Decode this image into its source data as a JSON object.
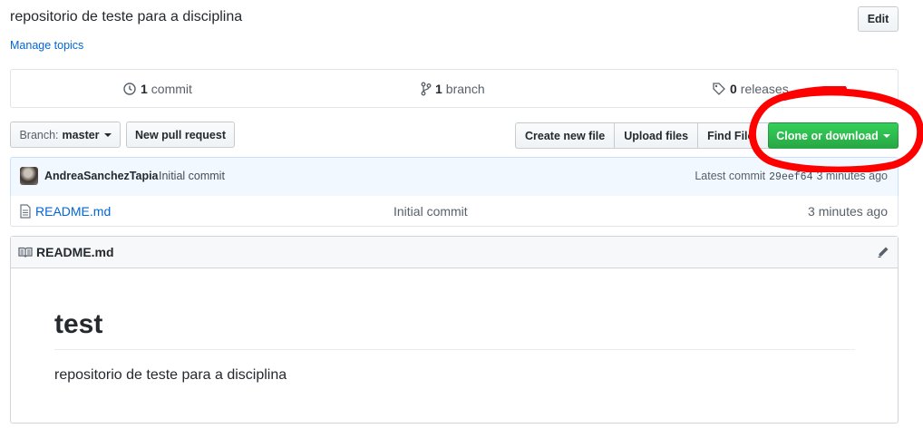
{
  "repo": {
    "description": "repositorio de teste para a disciplina",
    "manage_topics": "Manage topics",
    "edit_label": "Edit"
  },
  "numbers_summary": {
    "commits_count": "1",
    "commits_label": "commit",
    "branches_count": "1",
    "branches_label": "branch",
    "releases_count": "0",
    "releases_label": "releases"
  },
  "toolbar": {
    "branch_label": "Branch:",
    "branch_value": "master",
    "new_pull_request": "New pull request",
    "create_new_file": "Create new file",
    "upload_files": "Upload files",
    "find_file": "Find File",
    "clone_or_download": "Clone or download"
  },
  "latest_commit": {
    "author": "AndreaSanchezTapia",
    "message": "Initial commit",
    "label": "Latest commit",
    "sha": "29eef64",
    "age": "3 minutes ago"
  },
  "files": [
    {
      "name": "README.md",
      "message": "Initial commit",
      "age": "3 minutes ago"
    }
  ],
  "readme": {
    "header_title": "README.md",
    "h1": "test",
    "paragraph": "repositorio de teste para a disciplina"
  },
  "colors": {
    "link": "#0366d6",
    "primary_green": "#28a745",
    "annotation_red": "#ff0000"
  }
}
